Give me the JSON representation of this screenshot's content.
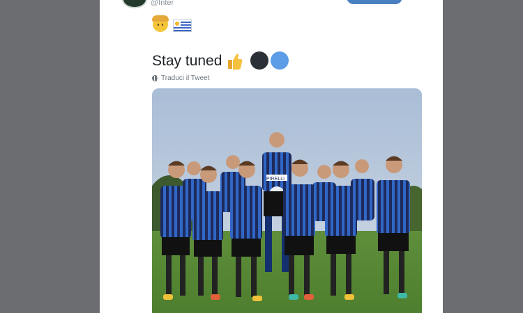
{
  "tweet": {
    "handle": "@Inter",
    "text": "Stay tuned",
    "translate_label": "Traduci il Tweet",
    "emojis": [
      "child-face-icon",
      "uruguay-flag-icon"
    ],
    "trailing_emojis": [
      "thumbs-up-icon",
      "black-circle-icon",
      "blue-circle-icon"
    ]
  },
  "colors": {
    "background": "#6b6d70",
    "card": "#ffffff",
    "button": "#4a80c2",
    "dark_circle": "#2c3137",
    "blue_circle": "#5d9ce6"
  },
  "photo": {
    "kit_text": "PIRELLI"
  }
}
